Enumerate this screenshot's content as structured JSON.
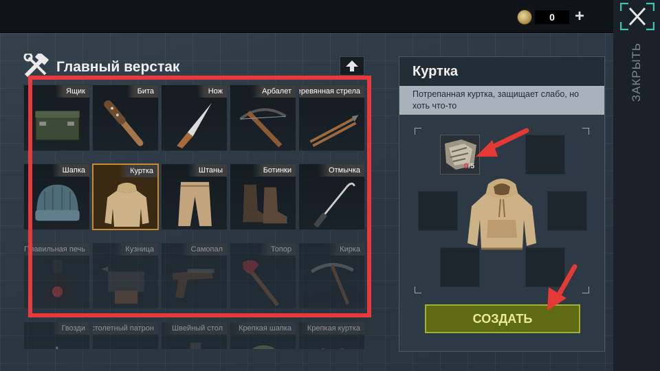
{
  "currency": {
    "amount": "0",
    "plus_label": "+"
  },
  "close_label": "ЗАКРЫТЬ",
  "workbench": {
    "title": "Главный верстак"
  },
  "items": [
    {
      "label": "Ящик",
      "icon": "crate-icon",
      "state": "available"
    },
    {
      "label": "Бита",
      "icon": "bat-icon",
      "state": "available"
    },
    {
      "label": "Нож",
      "icon": "knife-icon",
      "state": "available"
    },
    {
      "label": "Арбалет",
      "icon": "crossbow-icon",
      "state": "available"
    },
    {
      "label": "Деревянная стрела",
      "icon": "arrows-icon",
      "state": "available"
    },
    {
      "label": "Шапка",
      "icon": "beanie-icon",
      "state": "available"
    },
    {
      "label": "Куртка",
      "icon": "jacket-icon",
      "state": "selected"
    },
    {
      "label": "Штаны",
      "icon": "pants-icon",
      "state": "available"
    },
    {
      "label": "Ботинки",
      "icon": "boots-icon",
      "state": "available"
    },
    {
      "label": "Отмычка",
      "icon": "lockpick-icon",
      "state": "available"
    },
    {
      "label": "Плавильная печь",
      "icon": "furnace-icon",
      "state": "locked"
    },
    {
      "label": "Кузница",
      "icon": "forge-icon",
      "state": "locked"
    },
    {
      "label": "Самопал",
      "icon": "pistol-icon",
      "state": "locked"
    },
    {
      "label": "Топор",
      "icon": "axe-icon",
      "state": "locked"
    },
    {
      "label": "Кирка",
      "icon": "pickaxe-icon",
      "state": "locked"
    },
    {
      "label": "Гвозди",
      "icon": "nails-icon",
      "state": "locked"
    },
    {
      "label": "Пистолетный патрон",
      "icon": "bullet-icon",
      "state": "locked"
    },
    {
      "label": "Швейный стол",
      "icon": "sewing-table-icon",
      "state": "locked"
    },
    {
      "label": "Крепкая шапка",
      "icon": "strong-hat-icon",
      "state": "locked"
    },
    {
      "label": "Крепкая куртка",
      "icon": "strong-jacket-icon",
      "state": "locked"
    }
  ],
  "detail": {
    "title": "Куртка",
    "description": "Потрепанная куртка, защищает слабо, но хоть что-то",
    "requirement": {
      "icon": "cloth-rags-icon",
      "have": "0",
      "need": "/5"
    },
    "result_icon": "jacket-icon",
    "create_label": "СОЗДАТЬ"
  },
  "colors": {
    "highlight": "#e83a3a",
    "create_button": "#5f6a14",
    "create_border": "#a8b229",
    "selected_border": "#c88a2c",
    "missing_count": "#e03a3a"
  }
}
